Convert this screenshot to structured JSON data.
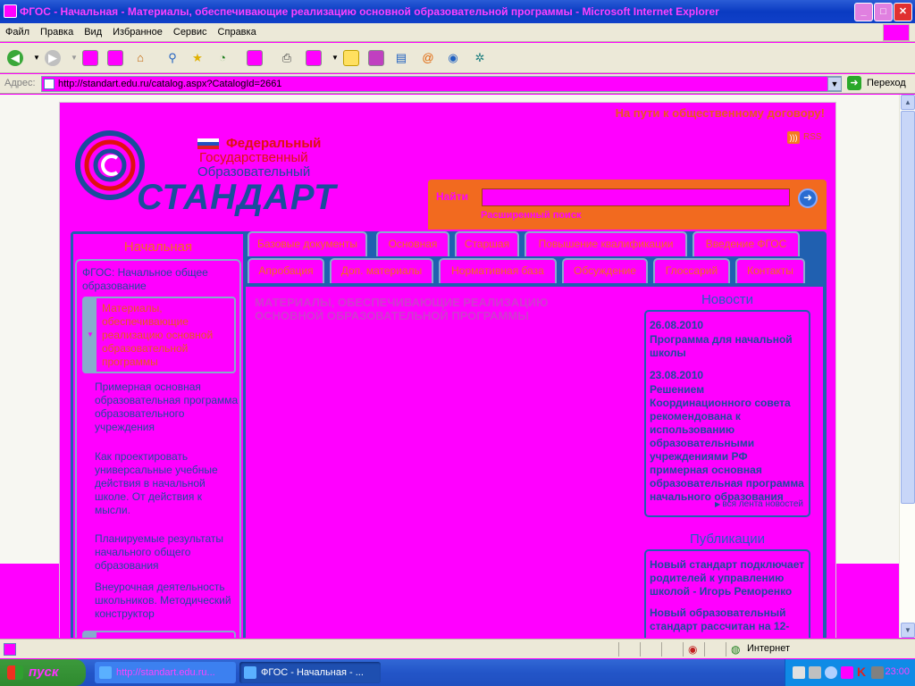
{
  "window": {
    "title": "ФГОС - Начальная - Материалы, обеспечивающие реализацию основной образовательной программы - Microsoft Internet Explorer"
  },
  "menu": [
    "Файл",
    "Правка",
    "Вид",
    "Избранное",
    "Сервис",
    "Справка"
  ],
  "address": {
    "label": "Адрес:",
    "url": "http://standart.edu.ru/catalog.aspx?CatalogId=2661",
    "go_label": "Переход"
  },
  "site": {
    "motto": "На пути к общественному договору!",
    "rss_label": "RSS",
    "logo": {
      "line1": "Федеральный",
      "line2": "Государственный",
      "line3": "Образовательный",
      "main": "СТАНДАРТ"
    },
    "search": {
      "label": "Найти",
      "value": "",
      "advanced": "Расширенный поиск"
    }
  },
  "tabs_row1": [
    "Базовые документы",
    "Основная",
    "Старшая",
    "Повышение квалификации",
    "Введение ФГОС"
  ],
  "tabs_row2": [
    "Апробация",
    "Доп. материалы",
    "Нормативная база",
    "Обсуждение",
    "Глоссарий",
    "Контакты"
  ],
  "sidebar": {
    "header": "Начальная",
    "section": "ФГОС: Начальное общее образование",
    "current": "Материалы, обеспечивающие реализацию основной образовательной программы",
    "links": [
      "Примерная основная образовательная программа образовательного учреждения",
      "Как проектировать универсальные учебные действия в начальной школе. От действия к мысли.",
      "Планируемые результаты начального общего образования",
      "Внеурочная деятельность школьников. Методический конструктор"
    ]
  },
  "content": {
    "title": "МАТЕРИАЛЫ, ОБЕСПЕЧИВАЮЩИЕ РЕАЛИЗАЦИЮ ОСНОВНОЙ ОБРАЗОВАТЕЛЬНОЙ ПРОГРАММЫ"
  },
  "news": {
    "header": "Новости",
    "items": [
      {
        "date": "26.08.2010",
        "text": "Программа для начальной школы"
      },
      {
        "date": "23.08.2010",
        "text": "Решением Координационного совета рекомендована к использованию образовательными учреждениями РФ примерная основная образовательная программа начального образования"
      }
    ],
    "more": "вся лента новостей"
  },
  "publications": {
    "header": "Публикации",
    "items": [
      "Новый стандарт подключает родителей к управлению школой - Игорь Реморенко",
      "Новый образовательный стандарт рассчитан на 12-"
    ]
  },
  "statusbar": {
    "zone": "Интернет"
  },
  "taskbar": {
    "start": "пуск",
    "tasks": [
      "http://standart.edu.ru...",
      "ФГОС - Начальная - ..."
    ],
    "clock": "23:00"
  },
  "colors": {
    "accent_orange": "#f26a1f",
    "link_blue": "#1a4c9c",
    "magenta": "#ff00ff",
    "nav_blue": "#2060b0"
  }
}
